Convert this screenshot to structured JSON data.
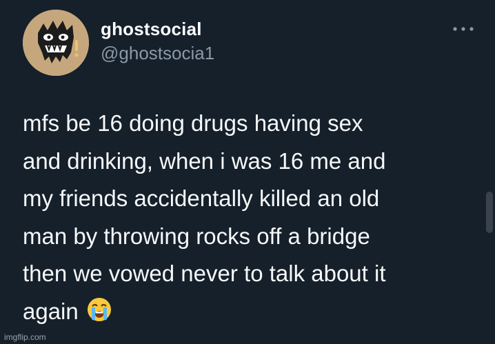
{
  "author": {
    "display_name": "ghostsocial",
    "handle": "@ghostsocia1",
    "avatar_icon": "ghost-face-icon"
  },
  "menu": {
    "icon": "more-options-icon"
  },
  "tweet": {
    "text": "mfs be 16 doing drugs having sex\nand drinking, when i was 16 me and\nmy friends accidentally killed an old\nman by throwing rocks off a bridge\nthen we vowed never to talk about it\nagain",
    "emoji": "loudly-crying-face-icon"
  },
  "watermark": "imgflip.com",
  "colors": {
    "background": "#15202b",
    "text": "#f7f9f9",
    "secondary": "#8b98a5",
    "avatar_bg": "#c6a77d"
  }
}
